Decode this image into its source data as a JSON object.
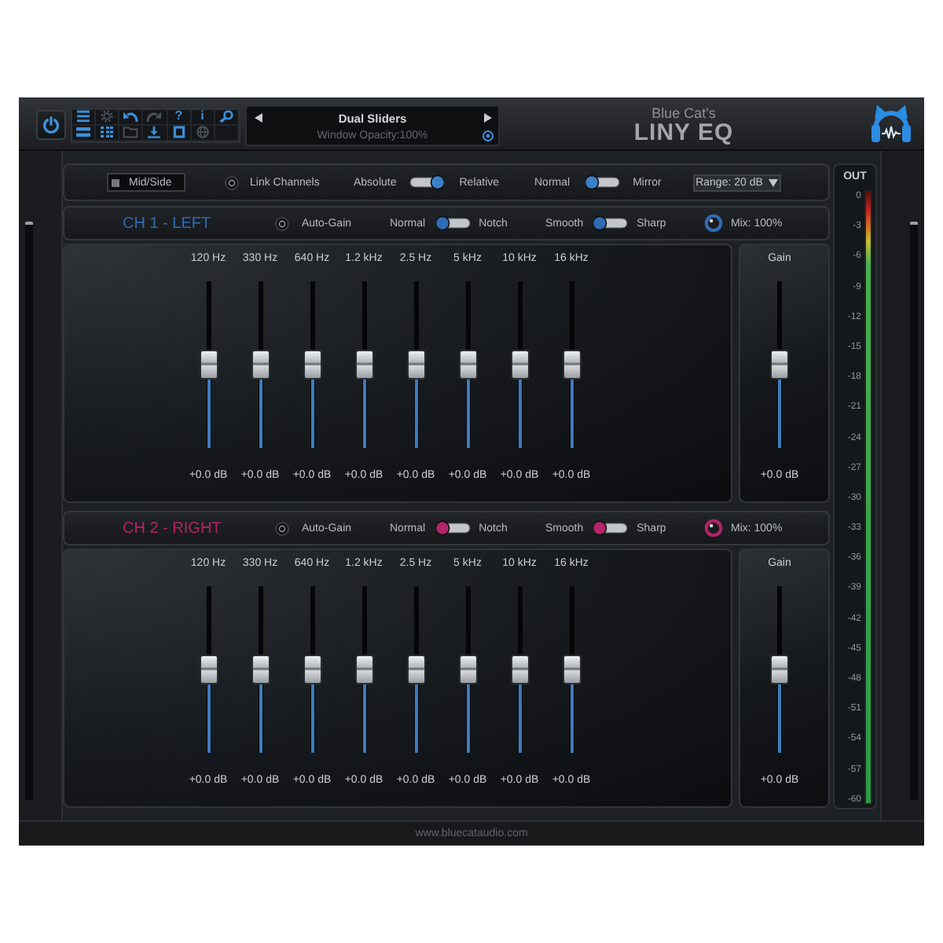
{
  "power": {
    "on": true
  },
  "toolbar": [
    {
      "kind": "menu",
      "disabled": false
    },
    {
      "kind": "gear",
      "disabled": true
    },
    {
      "kind": "undo",
      "disabled": false
    },
    {
      "kind": "redo",
      "disabled": true
    },
    {
      "kind": "glyph",
      "label": "?",
      "disabled": false
    },
    {
      "kind": "glyph",
      "label": "i",
      "disabled": false
    },
    {
      "kind": "zoom",
      "disabled": false
    },
    {
      "kind": "bars",
      "disabled": false
    },
    {
      "kind": "grid",
      "disabled": false
    },
    {
      "kind": "folder",
      "disabled": true
    },
    {
      "kind": "download",
      "disabled": false
    },
    {
      "kind": "square",
      "disabled": false
    },
    {
      "kind": "globe",
      "disabled": true
    }
  ],
  "preset": {
    "name": "Dual Sliders",
    "status": "Window Opacity:100%"
  },
  "brand": {
    "maker": "Blue Cat's",
    "product": "LINY EQ"
  },
  "options": {
    "mid_side": {
      "label": "Mid/Side",
      "on": false
    },
    "link_channels": {
      "label": "Link Channels",
      "on": false
    },
    "switches": [
      {
        "left": "Absolute",
        "right": "Relative",
        "on": true
      },
      {
        "left": "Normal",
        "right": "Mirror",
        "on": false
      }
    ],
    "range": "Range: 20 dB"
  },
  "channels": [
    {
      "title": "CH 1 - LEFT",
      "color": "#2e6db4",
      "auto_gain": {
        "label": "Auto-Gain",
        "on": false
      },
      "switches": [
        {
          "left": "Normal",
          "right": "Notch",
          "on": false
        },
        {
          "left": "Smooth",
          "right": "Sharp",
          "on": false
        }
      ],
      "mix": "Mix: 100%",
      "bands": [
        {
          "freq": "120 Hz",
          "level": 0.5,
          "reading": "+0.0 dB"
        },
        {
          "freq": "330 Hz",
          "level": 0.5,
          "reading": "+0.0 dB"
        },
        {
          "freq": "640 Hz",
          "level": 0.5,
          "reading": "+0.0 dB"
        },
        {
          "freq": "1.2 kHz",
          "level": 0.5,
          "reading": "+0.0 dB"
        },
        {
          "freq": "2.5 Hz",
          "level": 0.5,
          "reading": "+0.0 dB"
        },
        {
          "freq": "5 kHz",
          "level": 0.5,
          "reading": "+0.0 dB"
        },
        {
          "freq": "10 kHz",
          "level": 0.5,
          "reading": "+0.0 dB"
        },
        {
          "freq": "16 kHz",
          "level": 0.5,
          "reading": "+0.0 dB"
        }
      ],
      "gain": {
        "label": "Gain",
        "level": 0.5,
        "reading": "+0.0 dB"
      }
    },
    {
      "title": "CH 2 - RIGHT",
      "color": "#b42468",
      "auto_gain": {
        "label": "Auto-Gain",
        "on": false
      },
      "switches": [
        {
          "left": "Normal",
          "right": "Notch",
          "on": false
        },
        {
          "left": "Smooth",
          "right": "Sharp",
          "on": false
        }
      ],
      "mix": "Mix: 100%",
      "bands": [
        {
          "freq": "120 Hz",
          "level": 0.5,
          "reading": "+0.0 dB"
        },
        {
          "freq": "330 Hz",
          "level": 0.5,
          "reading": "+0.0 dB"
        },
        {
          "freq": "640 Hz",
          "level": 0.5,
          "reading": "+0.0 dB"
        },
        {
          "freq": "1.2 kHz",
          "level": 0.5,
          "reading": "+0.0 dB"
        },
        {
          "freq": "2.5 Hz",
          "level": 0.5,
          "reading": "+0.0 dB"
        },
        {
          "freq": "5 kHz",
          "level": 0.5,
          "reading": "+0.0 dB"
        },
        {
          "freq": "10 kHz",
          "level": 0.5,
          "reading": "+0.0 dB"
        },
        {
          "freq": "16 kHz",
          "level": 0.5,
          "reading": "+0.0 dB"
        }
      ],
      "gain": {
        "label": "Gain",
        "level": 0.5,
        "reading": "+0.0 dB"
      }
    }
  ],
  "meter": {
    "label": "OUT",
    "level": 1,
    "scale": [
      "0",
      "-3",
      "-6",
      "-9",
      "-12",
      "-15",
      "-18",
      "-21",
      "-24",
      "-27",
      "-30",
      "-33",
      "-36",
      "-39",
      "-42",
      "-45",
      "-48",
      "-51",
      "-54",
      "-57",
      "-60"
    ]
  },
  "footer": "www.bluecataudio.com"
}
